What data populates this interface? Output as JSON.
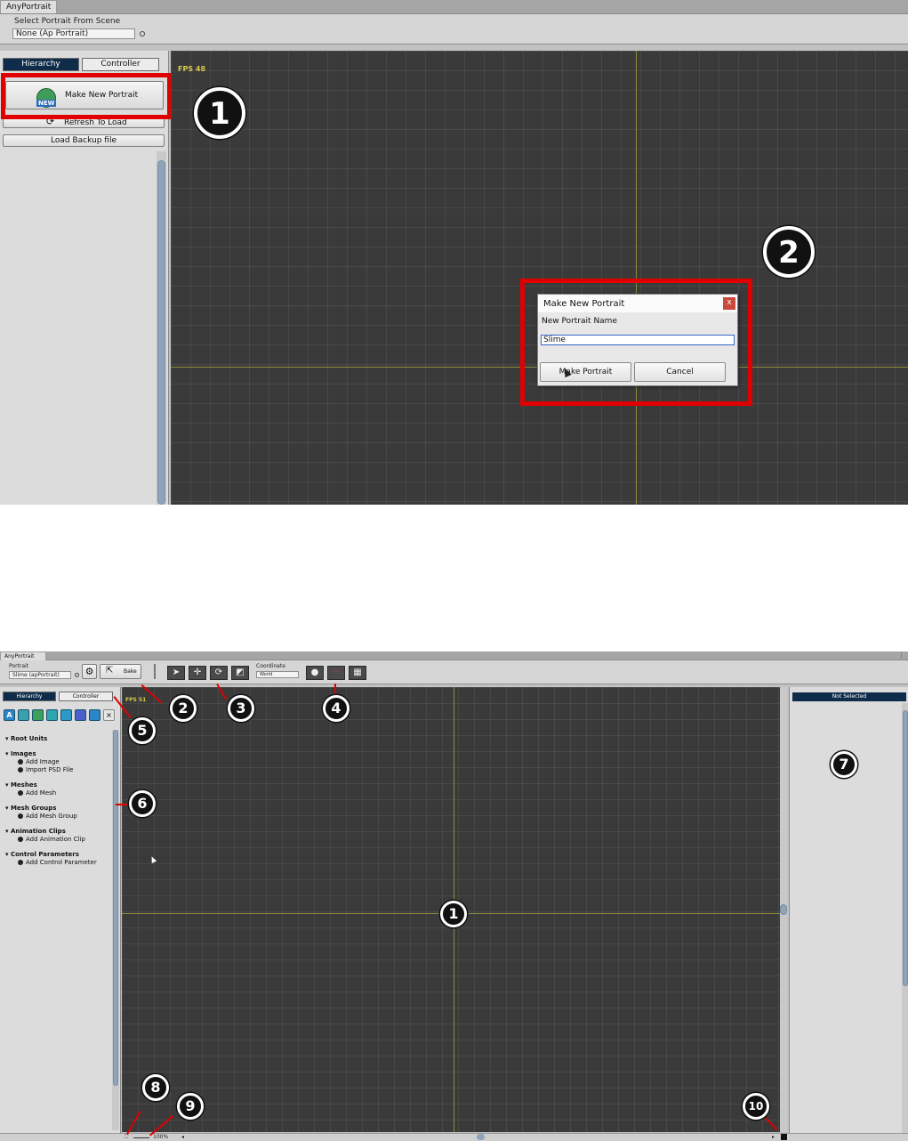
{
  "top": {
    "window_tab": "AnyPortrait",
    "select_label": "Select Portrait From Scene",
    "select_value": "None (Ap Portrait)",
    "tabs": {
      "hierarchy": "Hierarchy",
      "controller": "Controller"
    },
    "make_new_portrait": "Make New Portrait",
    "new_badge": "NEW",
    "refresh_to_load": "Refresh To Load",
    "load_backup": "Load Backup file",
    "fps": "FPS 48",
    "callout_1": "1",
    "callout_2": "2",
    "dialog": {
      "title": "Make New Portrait",
      "close": "x",
      "label": "New Portrait Name",
      "input_value": "Slime",
      "ok_button": "Make Portrait",
      "cancel_button": "Cancel"
    },
    "highlight_color": "#e00000"
  },
  "bottom": {
    "window_tab": "AnyPortrait",
    "portrait_label": "Portrait",
    "portrait_value": "Slime (apPortrait)",
    "bake_button": "Bake",
    "coordinate_label": "Coordinate",
    "coordinate_value": "World",
    "tabs": {
      "hierarchy": "Hierarchy",
      "controller": "Controller"
    },
    "fps": "FPS 51",
    "not_selected": "Not Selected",
    "zoom": "100%",
    "filter_icons": [
      "A",
      "",
      "",
      "",
      "",
      "",
      "",
      ""
    ],
    "tree": {
      "root_units": "Root Units",
      "images": "Images",
      "add_image": "Add Image",
      "import_psd": "Import PSD File",
      "meshes": "Meshes",
      "add_mesh": "Add Mesh",
      "mesh_groups": "Mesh Groups",
      "add_mesh_group": "Add Mesh Group",
      "animation_clips": "Animation Clips",
      "add_animation_clip": "Add Animation Clip",
      "control_parameters": "Control Parameters",
      "add_control_parameter": "Add Control Parameter"
    },
    "callouts": {
      "c1": "1",
      "c2": "2",
      "c3": "3",
      "c4": "4",
      "c5": "5",
      "c6": "6",
      "c7": "7",
      "c8": "8",
      "c9": "9",
      "c10": "10"
    }
  }
}
